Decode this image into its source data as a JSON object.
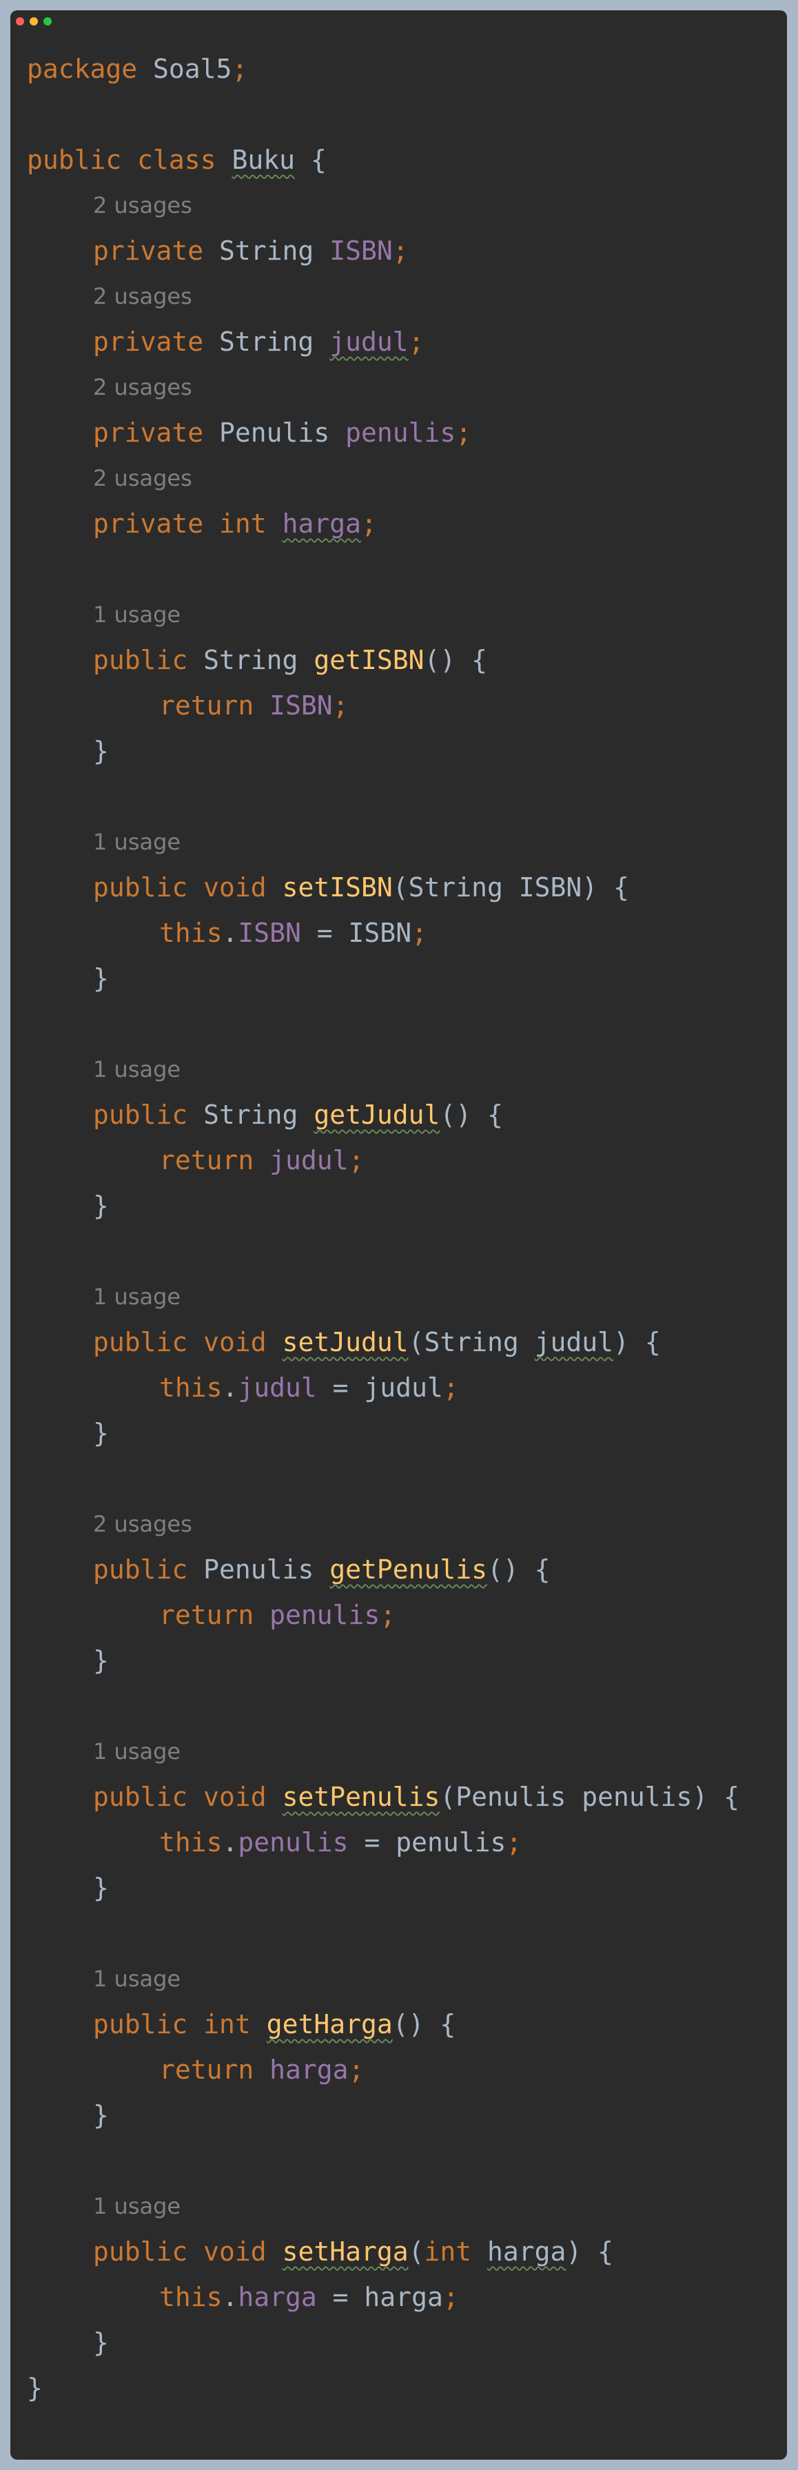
{
  "window": {
    "traffic_lights": [
      "close",
      "minimize",
      "zoom"
    ]
  },
  "code": {
    "package": {
      "kw": "package",
      "name": "Soal5",
      "semi": ";"
    },
    "class_decl": {
      "kw1": "public",
      "kw2": "class",
      "name": "Buku",
      "brace": "{"
    },
    "fields": [
      {
        "usage": "2 usages",
        "kw": "private",
        "type": "String",
        "name": "ISBN",
        "semi": ";"
      },
      {
        "usage": "2 usages",
        "kw": "private",
        "type": "String",
        "name": "judul",
        "semi": ";"
      },
      {
        "usage": "2 usages",
        "kw": "private",
        "type": "Penulis",
        "name": "penulis",
        "semi": ";"
      },
      {
        "usage": "2 usages",
        "kw": "private",
        "type": "int",
        "name": "harga",
        "semi": ";"
      }
    ],
    "methods": [
      {
        "usage": "1 usage",
        "kw": "public",
        "ret": "String",
        "name": "getISBN",
        "params": "() {",
        "body_kw": "return",
        "body_field": "ISBN",
        "close": "}"
      },
      {
        "usage": "1 usage",
        "kw": "public",
        "ret": "void",
        "name": "setISBN",
        "params": "(String ISBN) {",
        "body_kw": "this",
        "body_field": "ISBN",
        "body_rest": " = ISBN",
        "close": "}"
      },
      {
        "usage": "1 usage",
        "kw": "public",
        "ret": "String",
        "name": "getJudul",
        "params": "() {",
        "body_kw": "return",
        "body_field": "judul",
        "close": "}"
      },
      {
        "usage": "1 usage",
        "kw": "public",
        "ret": "void",
        "name": "setJudul",
        "params_open": "(String ",
        "params_name": "judul",
        "params_close": ") {",
        "body_kw": "this",
        "body_field": "judul",
        "body_rest": " = judul",
        "close": "}"
      },
      {
        "usage": "2 usages",
        "kw": "public",
        "ret": "Penulis",
        "name": "getPenulis",
        "params": "() {",
        "body_kw": "return",
        "body_field": "penulis",
        "close": "}"
      },
      {
        "usage": "1 usage",
        "kw": "public",
        "ret": "void",
        "name": "setPenulis",
        "params": "(Penulis penulis) {",
        "body_kw": "this",
        "body_field": "penulis",
        "body_rest": " = penulis",
        "close": "}"
      },
      {
        "usage": "1 usage",
        "kw": "public",
        "ret": "int",
        "name": "getHarga",
        "params": "() {",
        "body_kw": "return",
        "body_field": "harga",
        "close": "}"
      },
      {
        "usage": "1 usage",
        "kw": "public",
        "ret": "void",
        "name": "setHarga",
        "params_open": "(",
        "params_kw": "int",
        "params_space": " ",
        "params_name": "harga",
        "params_close": ") {",
        "body_kw": "this",
        "body_field": "harga",
        "body_rest": " = harga",
        "close": "}"
      }
    ],
    "class_close": "}",
    "semi": ";",
    "dot": "."
  }
}
